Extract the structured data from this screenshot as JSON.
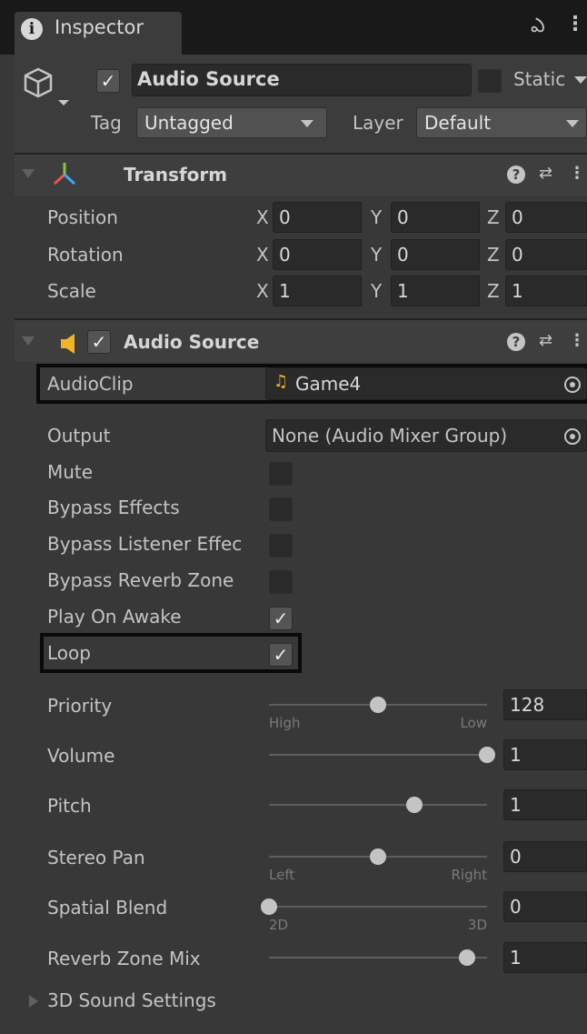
{
  "tab": {
    "title": "Inspector",
    "info_glyph": "i",
    "lock_glyph": "ఎ",
    "menu_glyph": "⋮"
  },
  "object": {
    "active": true,
    "name": "Audio Source",
    "static_label": "Static",
    "static_checked": false,
    "tag_label": "Tag",
    "tag_value": "Untagged",
    "layer_label": "Layer",
    "layer_value": "Default"
  },
  "transform": {
    "title": "Transform",
    "rows": [
      {
        "label": "Position",
        "x": "0",
        "y": "0",
        "z": "0"
      },
      {
        "label": "Rotation",
        "x": "0",
        "y": "0",
        "z": "0"
      },
      {
        "label": "Scale",
        "x": "1",
        "y": "1",
        "z": "1"
      }
    ],
    "axes": [
      "X",
      "Y",
      "Z"
    ]
  },
  "audio_source": {
    "title": "Audio Source",
    "enabled": true,
    "audioclip_label": "AudioClip",
    "audioclip_value": "Game4",
    "output_label": "Output",
    "output_value": "None (Audio Mixer Group)",
    "toggles": [
      {
        "label": "Mute",
        "checked": false
      },
      {
        "label": "Bypass Effects",
        "checked": false
      },
      {
        "label": "Bypass Listener Effec",
        "checked": false
      },
      {
        "label": "Bypass Reverb Zone",
        "checked": false
      },
      {
        "label": "Play On Awake",
        "checked": true
      },
      {
        "label": "Loop",
        "checked": true
      }
    ],
    "sliders": [
      {
        "label": "Priority",
        "value": "128",
        "fraction": 0.5,
        "min_label": "High",
        "max_label": "Low"
      },
      {
        "label": "Volume",
        "value": "1",
        "fraction": 1.0
      },
      {
        "label": "Pitch",
        "value": "1",
        "fraction": 0.667
      },
      {
        "label": "Stereo Pan",
        "value": "0",
        "fraction": 0.5,
        "min_label": "Left",
        "max_label": "Right"
      },
      {
        "label": "Spatial Blend",
        "value": "0",
        "fraction": 0.0,
        "min_label": "2D",
        "max_label": "3D"
      },
      {
        "label": "Reverb Zone Mix",
        "value": "1",
        "fraction": 0.909
      }
    ],
    "sound_settings_label": "3D Sound Settings"
  },
  "colors": {
    "background": "#383838",
    "tabbar": "#191919",
    "text": "#c4c4c4",
    "field": "#2a2a2a",
    "clip_icon": "#f0b429",
    "speaker_icon": "#f0b429"
  }
}
